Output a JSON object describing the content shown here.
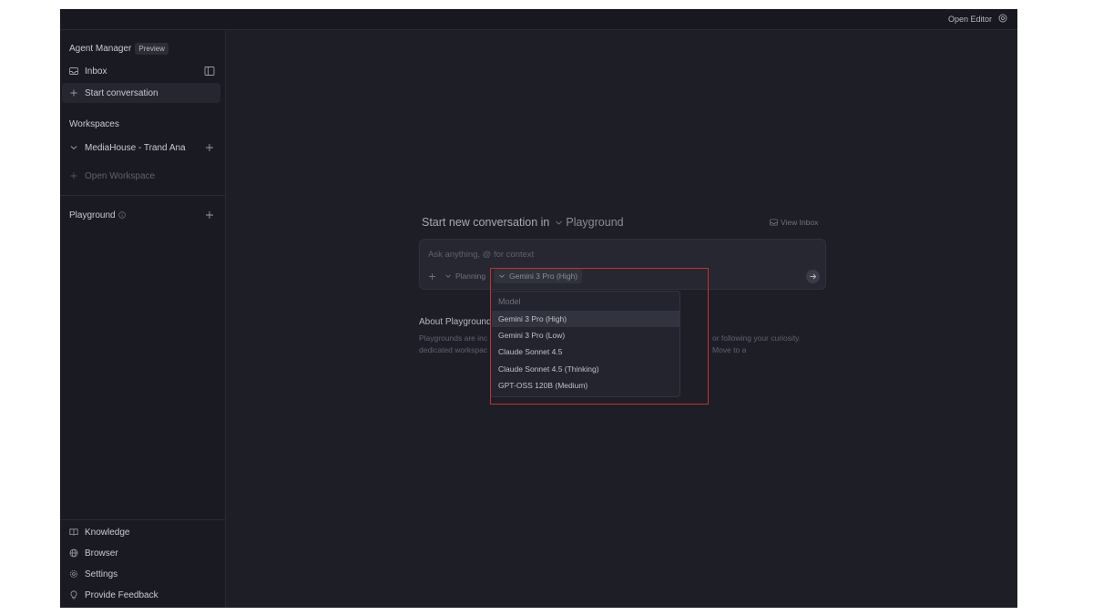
{
  "topbar": {
    "open_editor_label": "Open Editor"
  },
  "sidebar": {
    "title": "Agent Manager",
    "badge": "Preview",
    "inbox_label": "Inbox",
    "start_conversation_label": "Start conversation",
    "workspaces_label": "Workspaces",
    "workspace_item": "MediaHouse - Trand Ana",
    "open_workspace_label": "Open Workspace",
    "playground_label": "Playground",
    "footer": [
      {
        "label": "Knowledge",
        "icon": "book-icon"
      },
      {
        "label": "Browser",
        "icon": "globe-icon"
      },
      {
        "label": "Settings",
        "icon": "gear-icon"
      },
      {
        "label": "Provide Feedback",
        "icon": "lightbulb-icon"
      }
    ]
  },
  "main": {
    "title_prefix": "Start new conversation in",
    "title_target": "Playground",
    "view_inbox_label": "View Inbox",
    "input_placeholder": "Ask anything, @ for context",
    "planning_label": "Planning",
    "model_label": "Gemini 3 Pro (High)",
    "about_title": "About Playgrounds",
    "about_text_left": "Playgrounds are inc",
    "about_text_right": "or following your curiosity. Move to a",
    "about_text_line2": "dedicated workspac"
  },
  "dropdown": {
    "header": "Model",
    "items": [
      "Gemini 3 Pro (High)",
      "Gemini 3 Pro (Low)",
      "Claude Sonnet 4.5",
      "Claude Sonnet 4.5 (Thinking)",
      "GPT-OSS 120B (Medium)"
    ],
    "selected": "Gemini 3 Pro (High)"
  },
  "colors": {
    "background": "#1d1e26",
    "sidebar": "#1a1b22",
    "highlight_box": "#c0352e"
  }
}
